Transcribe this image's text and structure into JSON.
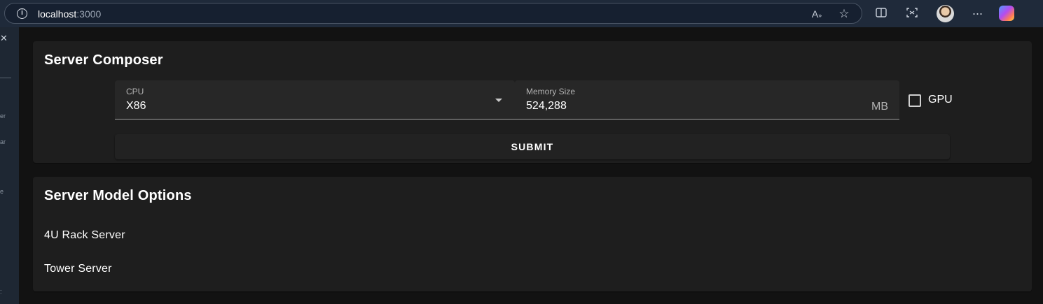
{
  "browser": {
    "url_host": "localhost",
    "url_port": ":3000",
    "info_icon": "info-icon",
    "read_aloud_icon": "read-aloud-icon",
    "favorite_icon": "star-icon",
    "split_icon": "split-screen-icon",
    "screenshot_icon": "screenshot-icon",
    "more_icon": "more-icon",
    "copilot_icon": "copilot-icon"
  },
  "sidebar": {
    "close_icon": "close-icon",
    "fragments": [
      "er",
      "ar",
      "e",
      ":"
    ]
  },
  "composer": {
    "title": "Server Composer",
    "cpu_label": "CPU",
    "cpu_value": "X86",
    "memory_label": "Memory Size",
    "memory_value": "524,288",
    "memory_unit": "MB",
    "gpu_label": "GPU",
    "gpu_checked": false,
    "submit_label": "SUBMIT"
  },
  "options": {
    "title": "Server Model Options",
    "items": [
      "4U Rack Server",
      "Tower Server"
    ]
  }
}
